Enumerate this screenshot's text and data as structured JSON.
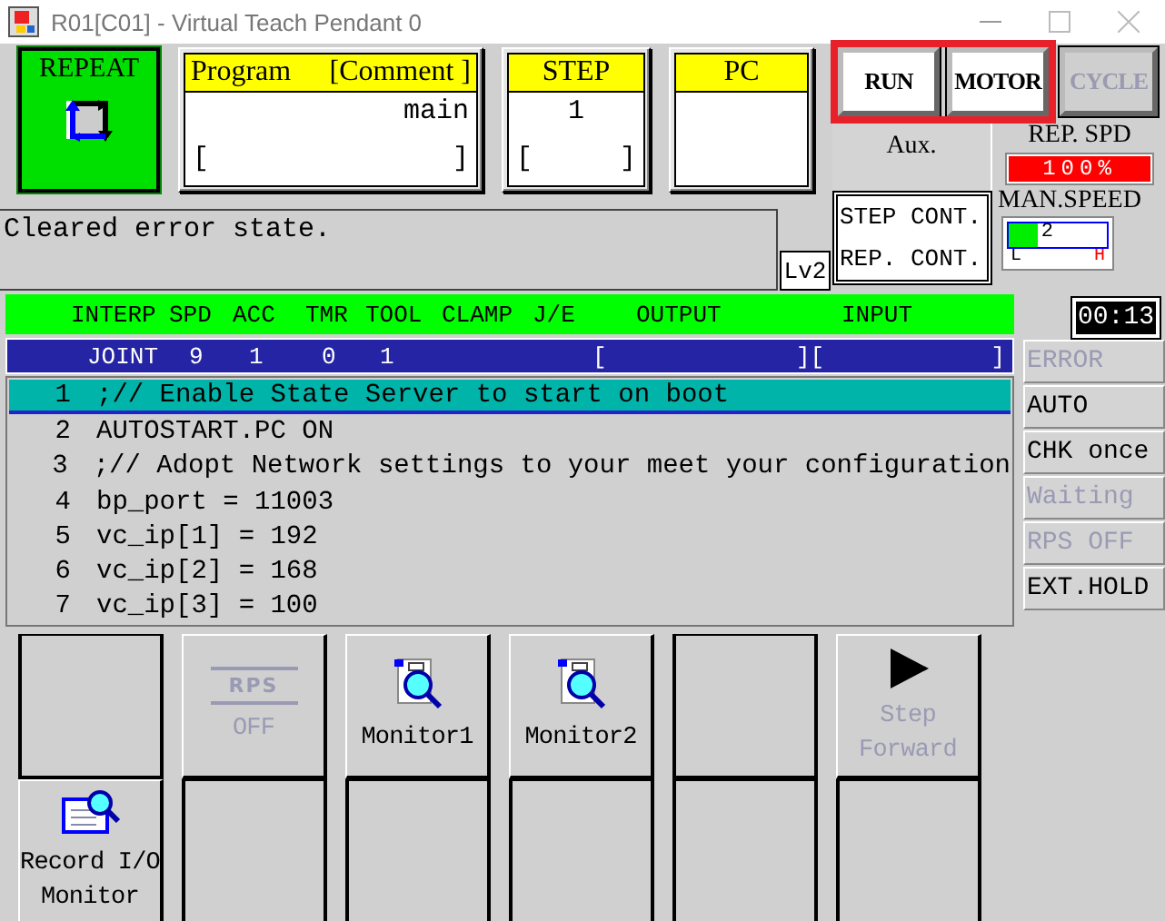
{
  "window": {
    "title": "R01[C01] - Virtual Teach Pendant 0"
  },
  "mode": {
    "label": "REPEAT"
  },
  "program": {
    "label": "Program",
    "comment_label": "[Comment ]",
    "name": "main",
    "comment_open": "[",
    "comment_close": "]"
  },
  "step": {
    "label": "STEP",
    "value": "1",
    "bracket_open": "[",
    "bracket_close": "]"
  },
  "pc": {
    "label": "PC"
  },
  "switches": [
    {
      "label": "RUN",
      "disabled": false,
      "highlighted": true
    },
    {
      "label": "MOTOR",
      "disabled": false,
      "highlighted": true
    },
    {
      "label": "CYCLE",
      "disabled": true,
      "highlighted": false
    }
  ],
  "aux": {
    "label": "Aux."
  },
  "rep_speed": {
    "label": "REP. SPD",
    "value": "100%"
  },
  "message": "Cleared error state.",
  "access_level": "Lv2",
  "continuous": {
    "step": "STEP CONT.",
    "repeat": "REP. CONT."
  },
  "manual_speed": {
    "label": "MAN.SPEED",
    "value": "2",
    "level": 0.3,
    "low": "L",
    "high": "H"
  },
  "timer": "00:13",
  "status_header": [
    "INTERP",
    "SPD",
    "ACC",
    "TMR",
    "TOOL",
    "CLAMP",
    "J/E",
    "OUTPUT",
    "INPUT"
  ],
  "status_values": [
    "JOINT",
    "9",
    "1",
    "0",
    "1",
    "[",
    "][",
    "]"
  ],
  "program_lines": [
    {
      "number": "1",
      "text": ";// Enable State Server to start on boot",
      "selected": true
    },
    {
      "number": "2",
      "text": "AUTOSTART.PC ON",
      "selected": false
    },
    {
      "number": "3",
      "text": ";// Adopt Network settings to your meet your configuration",
      "selected": false
    },
    {
      "number": "4",
      "text": "bp_port = 11003",
      "selected": false
    },
    {
      "number": "5",
      "text": "vc_ip[1] = 192",
      "selected": false
    },
    {
      "number": "6",
      "text": "vc_ip[2] = 168",
      "selected": false
    },
    {
      "number": "7",
      "text": "vc_ip[3] = 100",
      "selected": false
    }
  ],
  "indicators": [
    {
      "label": "ERROR",
      "active": false
    },
    {
      "label": "AUTO",
      "active": true
    },
    {
      "label": "CHK once",
      "active": true
    },
    {
      "label": "Waiting",
      "active": false
    },
    {
      "label": "RPS OFF",
      "active": false
    },
    {
      "label": "EXT.HOLD",
      "active": true
    }
  ],
  "softkeys": [
    {
      "kind": "empty"
    },
    {
      "kind": "rps",
      "badge": "RPS",
      "label": "OFF",
      "disabled": true
    },
    {
      "kind": "monitor",
      "label": "Monitor1",
      "disabled": false
    },
    {
      "kind": "monitor",
      "label": "Monitor2",
      "disabled": false
    },
    {
      "kind": "empty"
    },
    {
      "kind": "play",
      "label": "Step Forward",
      "disabled": true
    },
    {
      "kind": "record",
      "label": "Record I/O Monitor",
      "disabled": false
    },
    {
      "kind": "empty"
    },
    {
      "kind": "empty"
    },
    {
      "kind": "empty"
    },
    {
      "kind": "empty"
    },
    {
      "kind": "empty"
    }
  ]
}
